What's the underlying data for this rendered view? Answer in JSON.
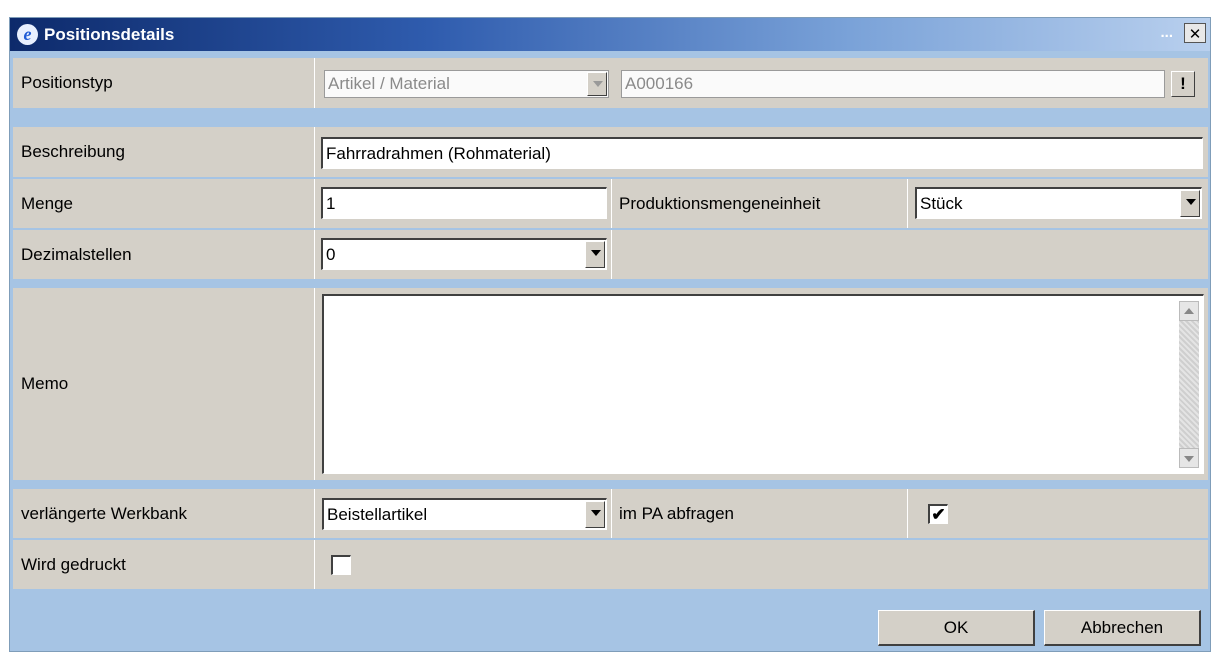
{
  "window": {
    "title": "Positionsdetails",
    "title_extra": "...",
    "close_symbol": "✕",
    "app_icon": "ie-icon"
  },
  "positionstyp": {
    "label": "Positionstyp",
    "type_value": "Artikel / Material",
    "code_value": "A000166",
    "pick_symbol": "!"
  },
  "beschreibung": {
    "label": "Beschreibung",
    "value": "Fahrradrahmen (Rohmaterial)"
  },
  "menge": {
    "label": "Menge",
    "value": "1",
    "unit_label": "Produktionsmengeneinheit",
    "unit_value": "Stück"
  },
  "dezimalstellen": {
    "label": "Dezimalstellen",
    "value": "0"
  },
  "memo": {
    "label": "Memo",
    "value": ""
  },
  "werkbank": {
    "label": "verlängerte Werkbank",
    "value": "Beistellartikel",
    "pa_label": "im PA abfragen",
    "pa_checked": true,
    "check_symbol": "✔"
  },
  "gedruckt": {
    "label": "Wird gedruckt",
    "checked": false
  },
  "buttons": {
    "ok": "OK",
    "cancel": "Abbrechen"
  }
}
